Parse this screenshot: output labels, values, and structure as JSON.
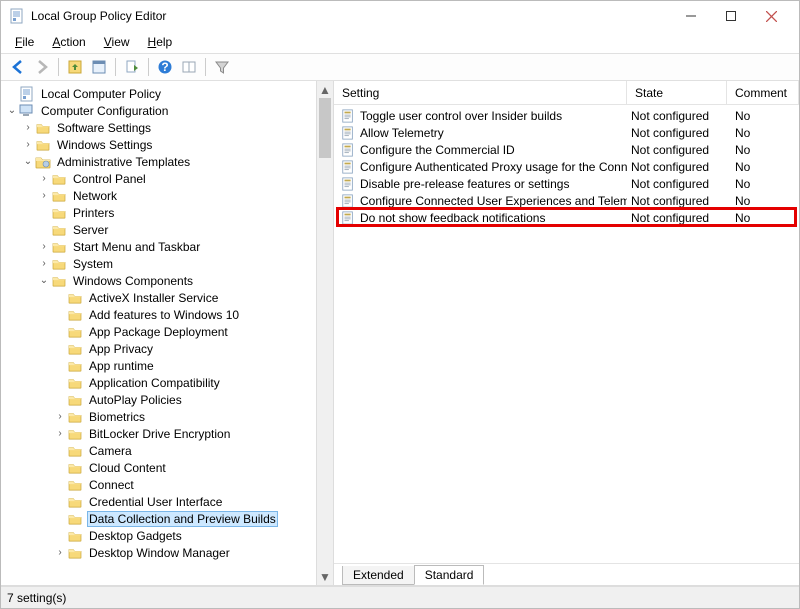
{
  "window": {
    "title": "Local Group Policy Editor"
  },
  "menu": {
    "file": "File",
    "action": "Action",
    "view": "View",
    "help": "Help"
  },
  "tree": {
    "root": "Local Computer Policy",
    "comp_conf": "Computer Configuration",
    "soft": "Software Settings",
    "win": "Windows Settings",
    "admin": "Administrative Templates",
    "ctrl": "Control Panel",
    "net": "Network",
    "print": "Printers",
    "serv": "Server",
    "start": "Start Menu and Taskbar",
    "sys": "System",
    "wc": "Windows Components",
    "wc_items": [
      "ActiveX Installer Service",
      "Add features to Windows 10",
      "App Package Deployment",
      "App Privacy",
      "App runtime",
      "Application Compatibility",
      "AutoPlay Policies",
      "Biometrics",
      "BitLocker Drive Encryption",
      "Camera",
      "Cloud Content",
      "Connect",
      "Credential User Interface",
      "Data Collection and Preview Builds",
      "Desktop Gadgets",
      "Desktop Window Manager"
    ],
    "selected_index": 13
  },
  "columns": {
    "setting": "Setting",
    "state": "State",
    "comment": "Comment"
  },
  "rows": [
    {
      "setting": "Toggle user control over Insider builds",
      "state": "Not configured",
      "comment": "No"
    },
    {
      "setting": "Allow Telemetry",
      "state": "Not configured",
      "comment": "No"
    },
    {
      "setting": "Configure the Commercial ID",
      "state": "Not configured",
      "comment": "No"
    },
    {
      "setting": "Configure Authenticated Proxy usage for the Conne",
      "state": "Not configured",
      "comment": "No"
    },
    {
      "setting": "Disable pre-release features or settings",
      "state": "Not configured",
      "comment": "No"
    },
    {
      "setting": "Configure Connected User Experiences and Telemet",
      "state": "Not configured",
      "comment": "No"
    },
    {
      "setting": "Do not show feedback notifications",
      "state": "Not configured",
      "comment": "No"
    }
  ],
  "highlight_row_index": 6,
  "tabs": {
    "extended": "Extended",
    "standard": "Standard"
  },
  "status": "7 setting(s)"
}
